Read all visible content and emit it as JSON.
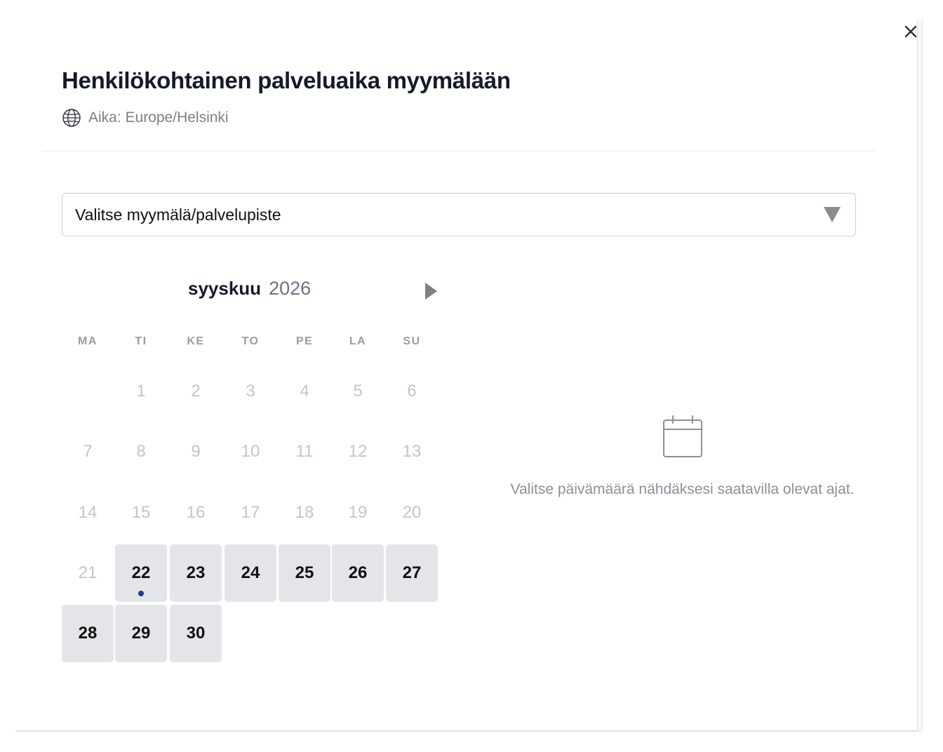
{
  "dialog": {
    "title": "Henkilökohtainen palveluaika myymälään",
    "timezone_label": "Aika: Europe/Helsinki",
    "close_icon": "close-icon"
  },
  "location_select": {
    "value": "Valitse myymälä/palvelupiste"
  },
  "calendar": {
    "month": "syyskuu",
    "year": "2026",
    "weekdays": [
      "MA",
      "TI",
      "KE",
      "TO",
      "PE",
      "LA",
      "SU"
    ],
    "days": [
      {
        "label": "1",
        "state": "disabled"
      },
      {
        "label": "2",
        "state": "disabled"
      },
      {
        "label": "3",
        "state": "disabled"
      },
      {
        "label": "4",
        "state": "disabled"
      },
      {
        "label": "5",
        "state": "disabled"
      },
      {
        "label": "6",
        "state": "disabled"
      },
      {
        "label": "7",
        "state": "disabled"
      },
      {
        "label": "8",
        "state": "disabled"
      },
      {
        "label": "9",
        "state": "disabled"
      },
      {
        "label": "10",
        "state": "disabled"
      },
      {
        "label": "11",
        "state": "disabled"
      },
      {
        "label": "12",
        "state": "disabled"
      },
      {
        "label": "13",
        "state": "disabled"
      },
      {
        "label": "14",
        "state": "disabled"
      },
      {
        "label": "15",
        "state": "disabled"
      },
      {
        "label": "16",
        "state": "disabled"
      },
      {
        "label": "17",
        "state": "disabled"
      },
      {
        "label": "18",
        "state": "disabled"
      },
      {
        "label": "19",
        "state": "disabled"
      },
      {
        "label": "20",
        "state": "disabled"
      },
      {
        "label": "21",
        "state": "disabled"
      },
      {
        "label": "22",
        "state": "available",
        "today": true
      },
      {
        "label": "23",
        "state": "available"
      },
      {
        "label": "24",
        "state": "available"
      },
      {
        "label": "25",
        "state": "available"
      },
      {
        "label": "26",
        "state": "available"
      },
      {
        "label": "27",
        "state": "available"
      },
      {
        "label": "28",
        "state": "available"
      },
      {
        "label": "29",
        "state": "available"
      },
      {
        "label": "30",
        "state": "available"
      }
    ]
  },
  "empty_state": {
    "icon": "calendar-icon",
    "text": "Valitse päivämäärä nähdäksesi saatavilla olevat ajat."
  },
  "colors": {
    "title": "#151a29",
    "available_bg": "#e4e5e8",
    "today_dot": "#2a3a8f",
    "disabled_text": "#c4c5ca"
  }
}
